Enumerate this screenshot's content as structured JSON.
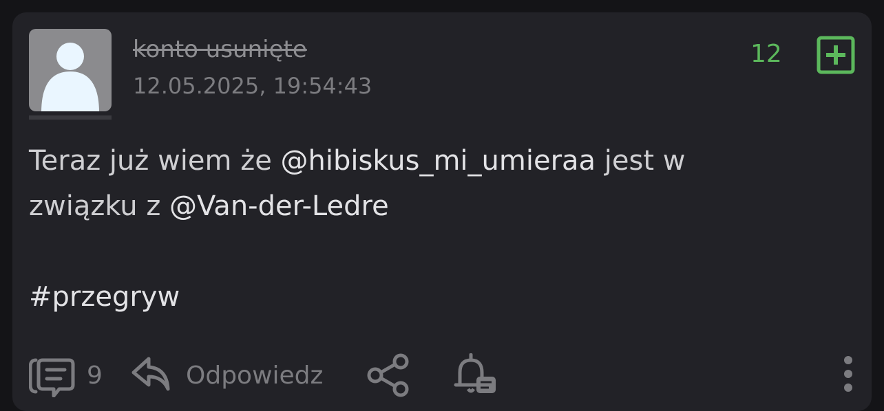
{
  "entry": {
    "author": "konto usunięte",
    "timestamp": "12.05.2025, 19:54:43",
    "votes": "12",
    "content": {
      "line1_text": "Teraz już wiem że ",
      "mention1": "@hibiskus_mi_umieraa",
      "line1_rest": " jest w",
      "line2_text": "związku z ",
      "mention2": "@Van-der-Ledre",
      "hashtag": "#przegryw"
    }
  },
  "footer": {
    "comments_count": "9",
    "reply_label": "Odpowiedz"
  },
  "colors": {
    "background": "#141417",
    "card": "#222227",
    "vote_green": "#5cb85c",
    "muted_text": "#7c7c80",
    "body_text": "#cfcfd2"
  },
  "icons": {
    "avatar": "default-user-avatar",
    "plus": "plus-square-icon",
    "comments": "comments-icon",
    "reply": "reply-arrow-icon",
    "share": "share-icon",
    "notify": "bell-icon",
    "more": "more-vertical-icon"
  }
}
